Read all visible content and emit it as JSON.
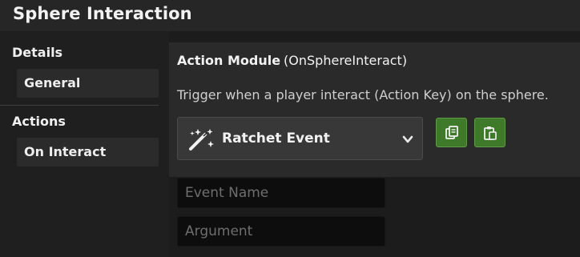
{
  "window": {
    "title": "Sphere Interaction"
  },
  "sidebar": {
    "sections": [
      {
        "header": "Details",
        "items": [
          {
            "label": "General"
          }
        ]
      },
      {
        "header": "Actions",
        "items": [
          {
            "label": "On Interact"
          }
        ]
      }
    ]
  },
  "main": {
    "module_label": "Action Module",
    "module_name": "(OnSphereInteract)",
    "description": "Trigger when a player interact (Action Key) on the sphere.",
    "event_dropdown": {
      "selected": "Ratchet Event",
      "icon": "magic-wand-icon"
    },
    "buttons": [
      {
        "icon": "copy-icon"
      },
      {
        "icon": "paste-icon"
      }
    ],
    "fields": [
      {
        "placeholder": "Event Name",
        "value": ""
      },
      {
        "placeholder": "Argument",
        "value": ""
      }
    ]
  },
  "colors": {
    "background": "#1e1e1e",
    "titlebar": "#262626",
    "panel": "#2a2a2a",
    "accent_green": "#3f7a2a",
    "input_bg": "#0d0d0d"
  }
}
